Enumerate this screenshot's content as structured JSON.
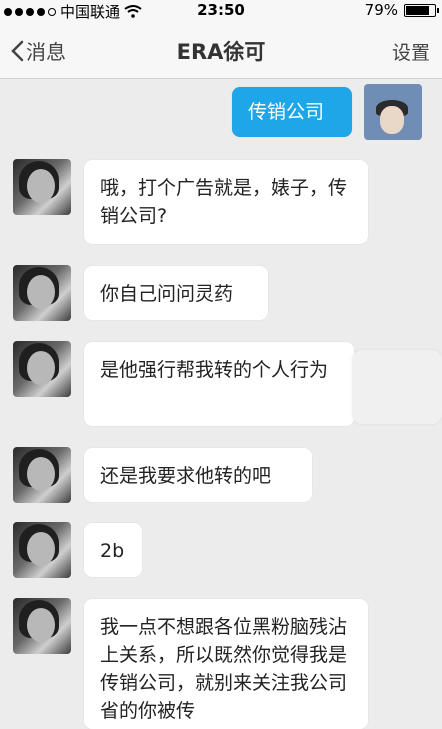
{
  "status": {
    "carrier": "中国联通",
    "time": "23:50",
    "battery": "79%"
  },
  "nav": {
    "back_label": "消息",
    "title": "ERA徐可",
    "settings_label": "设置"
  },
  "messages": [
    {
      "from": "me",
      "text": "传销公司"
    },
    {
      "from": "other",
      "text": "哦，打个广告就是，婊子，传销公司?"
    },
    {
      "from": "other",
      "text": "你自己问问灵药"
    },
    {
      "from": "other",
      "text": "是他强行帮我转的个人行为"
    },
    {
      "from": "other",
      "text": "还是我要求他转的吧"
    },
    {
      "from": "other",
      "text": "2b"
    },
    {
      "from": "other",
      "text": "我一点不想跟各位黑粉脑残沾上关系，所以既然你觉得我是传销公司，就别来关注我公司 省的你被传"
    }
  ],
  "colors": {
    "sent_bubble": "#1ea6e8",
    "received_bubble": "#ffffff",
    "background": "#ececec"
  }
}
